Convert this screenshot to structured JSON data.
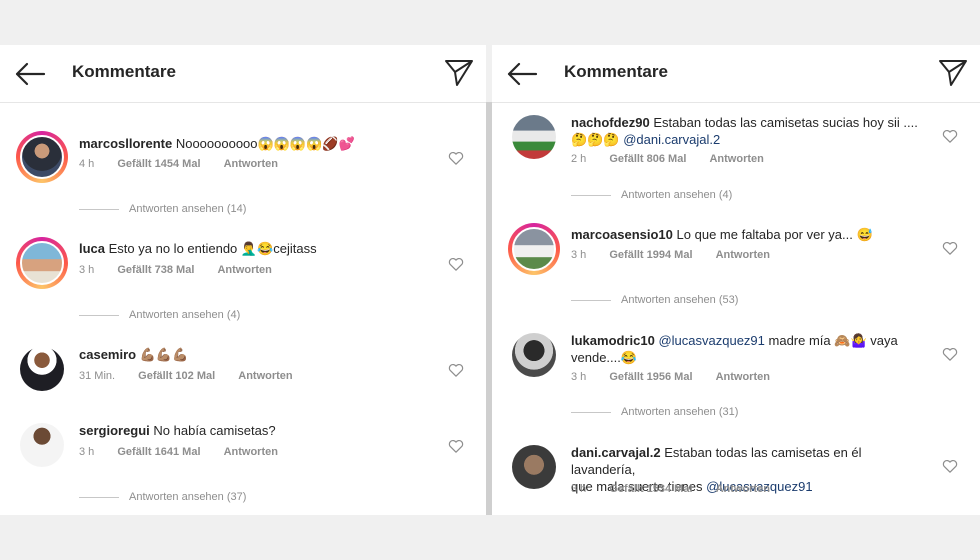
{
  "left": {
    "header": {
      "title": "Kommentare"
    },
    "comments": [
      {
        "user": "marcosllorente",
        "text": "Noooooooooo😱😱😱😱🏈💕",
        "time": "4 h",
        "likes": "Gefällt 1454 Mal",
        "reply": "Antworten",
        "replies": "Antworten ansehen (14)"
      },
      {
        "user": "luca",
        "text": "Esto ya no lo entiendo 🤦‍♂️😂cejitass",
        "time": "3 h",
        "likes": "Gefällt 738 Mal",
        "reply": "Antworten",
        "replies": "Antworten ansehen (4)"
      },
      {
        "user": "casemiro",
        "text": "💪🏽💪🏽💪🏽",
        "time": "31 Min.",
        "likes": "Gefällt 102 Mal",
        "reply": "Antworten"
      },
      {
        "user": "sergioregui",
        "text": "No había camisetas?",
        "time": "3 h",
        "likes": "Gefällt 1641 Mal",
        "reply": "Antworten",
        "replies": "Antworten ansehen (37)"
      }
    ]
  },
  "right": {
    "header": {
      "title": "Kommentare"
    },
    "comments": [
      {
        "user": "nachofdez90",
        "text": "Estaban todas las camisetas sucias hoy sii ....",
        "text2": "🤔🤔🤔",
        "mention": "@dani.carvajal.2",
        "time": "2 h",
        "likes": "Gefällt 806 Mal",
        "reply": "Antworten",
        "replies": "Antworten ansehen (4)"
      },
      {
        "user": "marcoasensio10",
        "text": "Lo que me faltaba por ver ya... 😅",
        "time": "3 h",
        "likes": "Gefällt 1994 Mal",
        "reply": "Antworten",
        "replies": "Antworten ansehen (53)"
      },
      {
        "user": "lukamodric10",
        "mention": "@lucasvazquez91",
        "text": "madre mía 🙈🤷‍♀️ vaya",
        "text2": "vende....😂",
        "time": "3 h",
        "likes": "Gefällt 1956 Mal",
        "reply": "Antworten",
        "replies": "Antworten ansehen (31)"
      },
      {
        "user": "dani.carvajal.2",
        "text": "Estaban todas las camisetas en él lavandería,",
        "text2": "que mala suerte tienes",
        "mention": "@lucasvazquez91",
        "time": "3 h",
        "likes": "Gefällt 1534 Mal",
        "reply": "Antworten"
      }
    ]
  }
}
